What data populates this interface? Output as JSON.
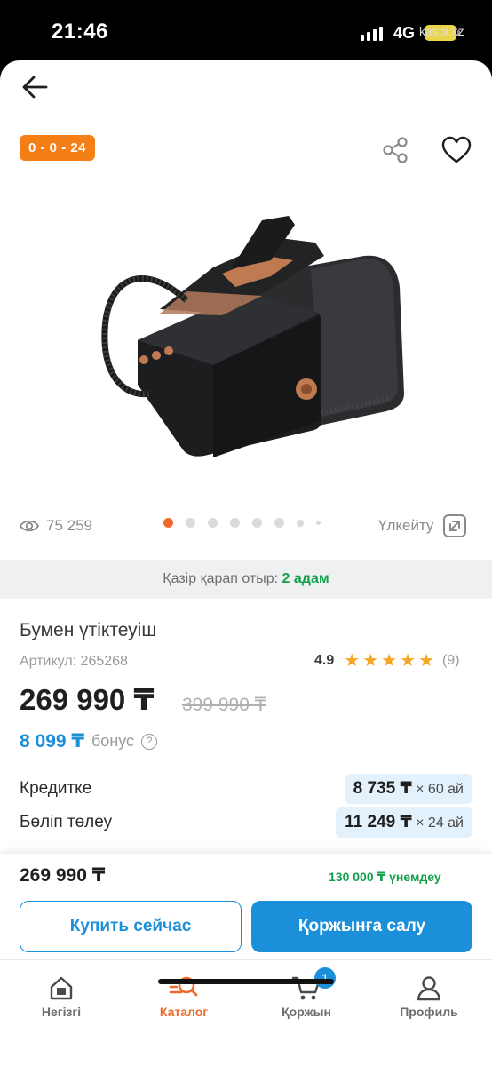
{
  "status_bar": {
    "time": "21:46",
    "network": "4G",
    "site": "kaspi.kz"
  },
  "product": {
    "promo_badge": "0 - 0 - 24",
    "views": "75 259",
    "zoom_label": "Үлкейту",
    "gallery": {
      "total": 8,
      "active_index": 0
    },
    "viewing_now_prefix": "Қазір қарап отыр:",
    "viewing_now_count": "2 адам",
    "title": "Бумен үтіктеуіш",
    "sku": "Артикул: 265268",
    "rating": {
      "value": "4.9",
      "stars": 5,
      "count": "(9)"
    },
    "price": "269 990 ₸",
    "old_price": "399 990 ₸",
    "bonus_amount": "8 099 ₸",
    "bonus_label": "бонус",
    "help_glyph": "?"
  },
  "payment_options": [
    {
      "label": "Кредитке",
      "amount": "8 735 ₸",
      "term": "× 60 ай"
    },
    {
      "label": "Бөліп төлеу",
      "amount": "11 249 ₸",
      "term": "× 24 ай"
    }
  ],
  "buy_panel": {
    "price": "269 990 ₸",
    "savings": "130 000 ₸ үнемдеу",
    "buy_now_label": "Купить сейчас",
    "add_to_cart_label": "Қоржынға салу"
  },
  "tabbar": {
    "items": [
      {
        "label": "Негізгі",
        "icon": "home-icon"
      },
      {
        "label": "Каталог",
        "icon": "catalog-search-icon",
        "active": true
      },
      {
        "label": "Қоржын",
        "icon": "cart-icon",
        "badge": "1"
      },
      {
        "label": "Профиль",
        "icon": "profile-icon"
      }
    ]
  },
  "colors": {
    "accent_orange": "#f06a2c",
    "primary_blue": "#1b8fd9",
    "success_green": "#12a14a",
    "star": "#f5a623"
  }
}
